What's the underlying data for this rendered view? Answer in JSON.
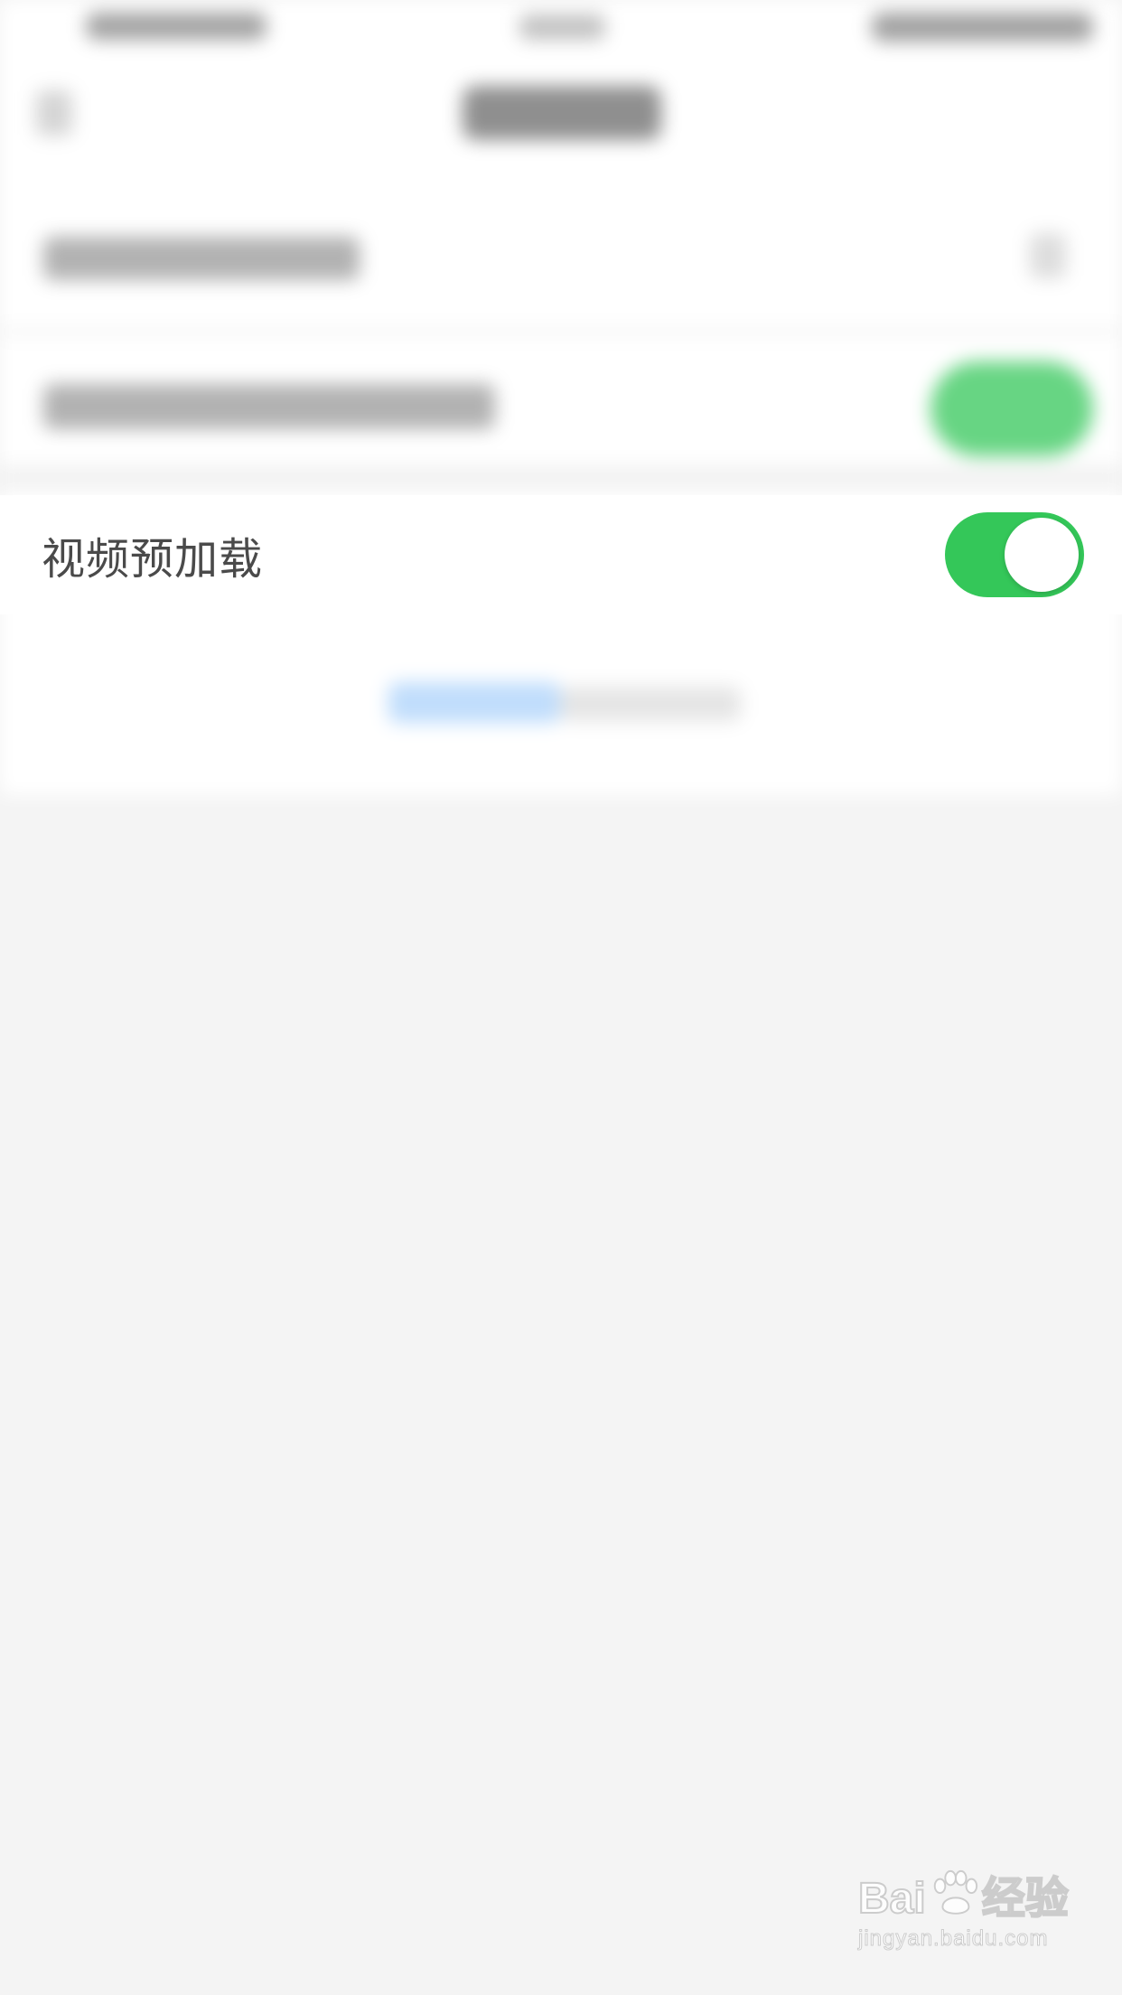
{
  "settings": {
    "video_preload": {
      "label": "视频预加载",
      "enabled": true
    }
  },
  "colors": {
    "toggle_on": "#34c759",
    "background": "#f4f4f4",
    "label_text": "#4a4a4a"
  },
  "watermark": {
    "brand_prefix": "Bai",
    "brand_suffix": "经验",
    "url": "jingyan.baidu.com"
  }
}
